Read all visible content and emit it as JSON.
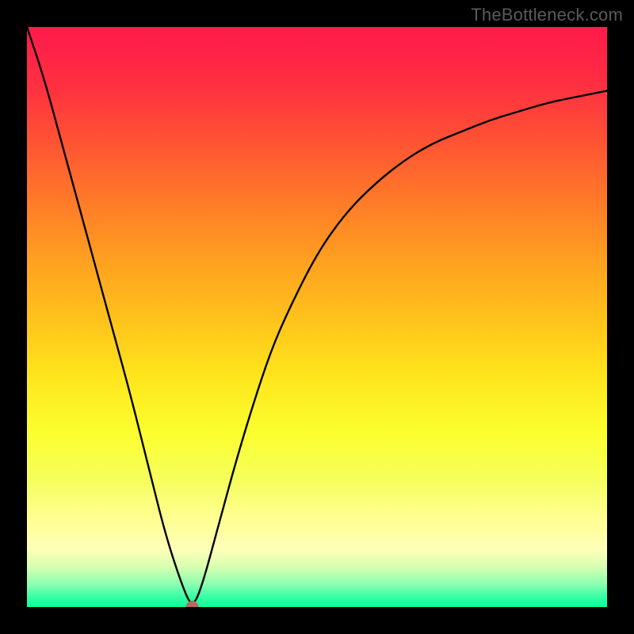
{
  "watermark": {
    "text": "TheBottleneck.com"
  },
  "chart_data": {
    "type": "line",
    "title": "",
    "xlabel": "",
    "ylabel": "",
    "xlim": [
      0,
      100
    ],
    "ylim": [
      0,
      100
    ],
    "grid": false,
    "legend": false,
    "background": {
      "gradient_direction": "vertical",
      "top_color_meaning": "bad",
      "bottom_color_meaning": "good",
      "stops": [
        {
          "pos": 0,
          "color": "#ff1a4b"
        },
        {
          "pos": 50,
          "color": "#ffc11c"
        },
        {
          "pos": 85,
          "color": "#ffffb8"
        },
        {
          "pos": 100,
          "color": "#0aff99"
        }
      ]
    },
    "series": [
      {
        "name": "bottleneck-curve",
        "color": "#000000",
        "x": [
          0,
          3,
          6,
          9,
          12,
          15,
          18,
          21,
          24,
          27,
          28.5,
          30,
          33,
          36,
          39,
          42,
          45,
          50,
          55,
          60,
          65,
          70,
          75,
          80,
          85,
          90,
          95,
          100
        ],
        "y": [
          100,
          91,
          80,
          69,
          58,
          47,
          36,
          24,
          12,
          3,
          0,
          3,
          14,
          25,
          35,
          44,
          51,
          61,
          68,
          73,
          77,
          80,
          82,
          84,
          85.5,
          87,
          88,
          89
        ]
      }
    ],
    "marker": {
      "name": "min-point",
      "x": 28.5,
      "y": 0,
      "color": "#b86a5a",
      "radius_px": 8
    },
    "notes": "x and y are in percent of the plot-area width/height; y measured from the bottom (0=bottom green line, 100=top red edge). Values are read approximately from the raster image."
  }
}
